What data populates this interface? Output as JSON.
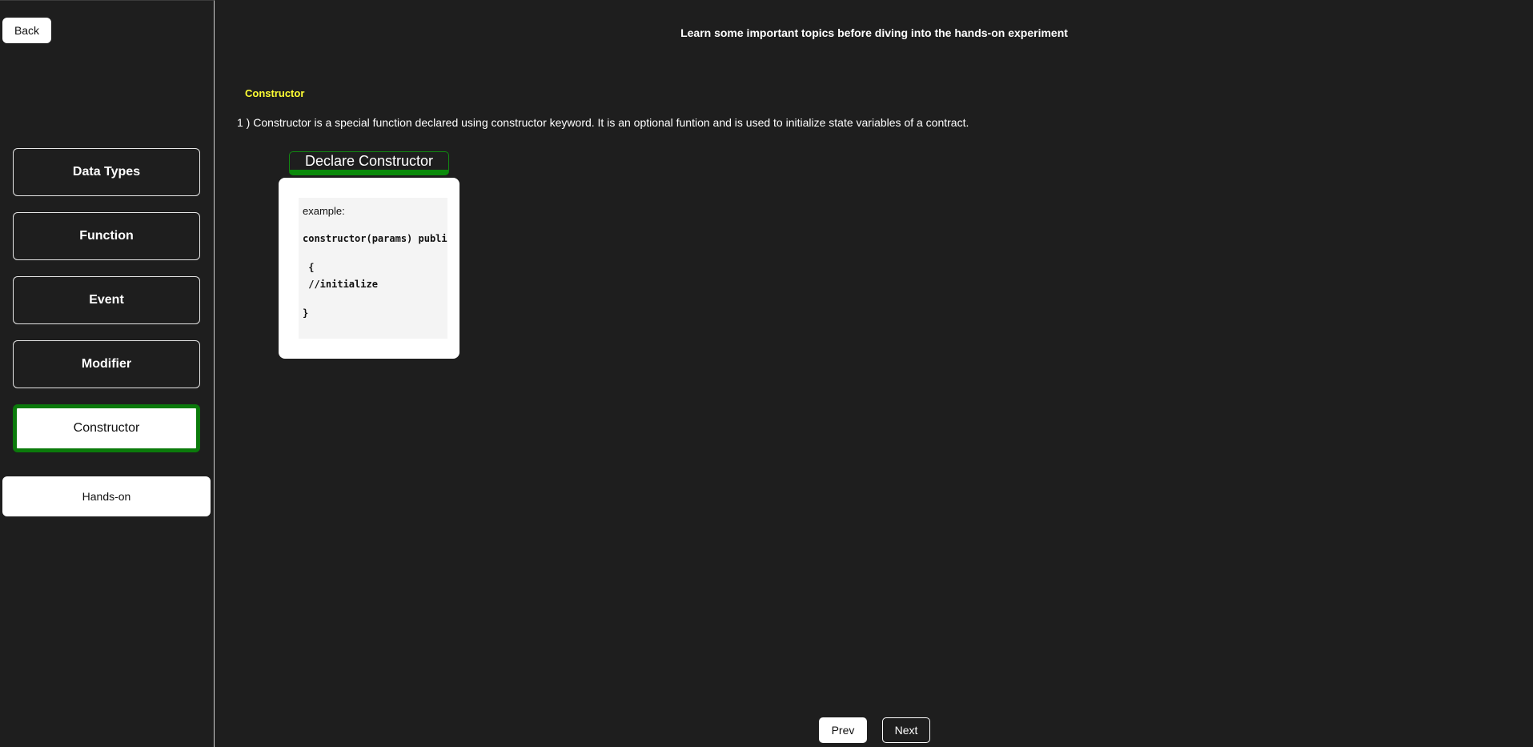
{
  "sidebar": {
    "back_label": "Back",
    "topics": [
      {
        "label": "Data Types"
      },
      {
        "label": "Function"
      },
      {
        "label": "Event"
      },
      {
        "label": "Modifier"
      },
      {
        "label": "Constructor",
        "active": true
      }
    ],
    "handson_label": "Hands-on"
  },
  "main": {
    "heading": "Learn some important topics before diving into the hands-on experiment",
    "section_title": "Constructor",
    "description": "1 ) Constructor is a special function declared using constructor keyword. It is an optional funtion and is used to initialize state variables of a contract.",
    "declare_button_label": "Declare Constructor",
    "code": {
      "example_label": "example:",
      "lines": [
        "constructor(params) public",
        " {",
        " //initialize",
        "}"
      ]
    }
  },
  "footer": {
    "prev_label": "Prev",
    "next_label": "Next"
  },
  "colors": {
    "background": "#1e1e1e",
    "accent_green": "#0b7a0b",
    "section_title_yellow": "#ffff33"
  }
}
